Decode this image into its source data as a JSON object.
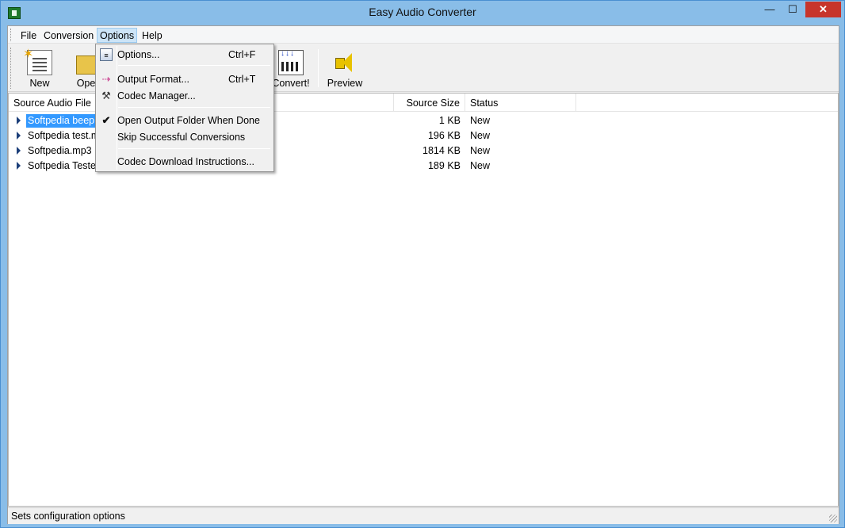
{
  "window": {
    "title": "Easy Audio Converter",
    "min_glyph": "—",
    "max_glyph": "☐",
    "close_glyph": "✕"
  },
  "menubar": {
    "file": "File",
    "conversion": "Conversion",
    "options": "Options",
    "help": "Help"
  },
  "toolbar": {
    "new": "New",
    "open": "Open",
    "convert": "Convert!",
    "preview": "Preview",
    "icons": [
      "new-document-icon",
      "open-folder-icon",
      "convert-icon",
      "speaker-icon"
    ]
  },
  "list": {
    "columns": [
      "Source Audio File",
      "Source Size",
      "Status"
    ],
    "rows": [
      {
        "name": "Softpedia beep.m",
        "size": "1 KB",
        "status": "New",
        "selected": true
      },
      {
        "name": "Softpedia test.m",
        "size": "196 KB",
        "status": "New"
      },
      {
        "name": "Softpedia.mp3",
        "size": "1814 KB",
        "status": "New"
      },
      {
        "name": "Softpedia Tested",
        "size": "189 KB",
        "status": "New"
      }
    ]
  },
  "options_menu": {
    "items": [
      {
        "label": "Options...",
        "shortcut": "Ctrl+F",
        "icon": "options-icon"
      },
      {
        "label": "Output Format...",
        "shortcut": "Ctrl+T",
        "icon": "output-format-icon"
      },
      {
        "label": "Codec Manager...",
        "shortcut": "",
        "icon": "codec-manager-icon"
      },
      {
        "label": "Open Output Folder When Done",
        "shortcut": "",
        "icon": "check-icon",
        "checked": true
      },
      {
        "label": "Skip Successful Conversions",
        "shortcut": ""
      },
      {
        "label": "Codec Download Instructions...",
        "shortcut": ""
      }
    ]
  },
  "statusbar": {
    "text": "Sets configuration options"
  },
  "colors": {
    "title_bar": "#89bde8",
    "close_button": "#c7352b",
    "selection": "#3399ff",
    "menu_highlight": "#cce4f7"
  }
}
